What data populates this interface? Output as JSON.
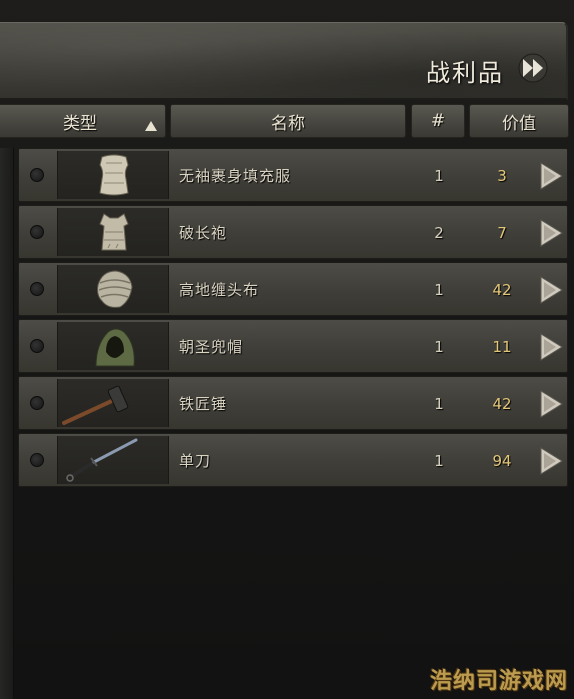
{
  "panel": {
    "title": "战利品",
    "fast_forward_icon": "fast-forward-icon"
  },
  "columns": {
    "type": "类型",
    "name": "名称",
    "count": "#",
    "value": "价值"
  },
  "items": [
    {
      "icon": "sleeveless-padded-vest-icon",
      "name": "无袖裹身填充服",
      "count": "1",
      "value": "3"
    },
    {
      "icon": "tattered-robe-icon",
      "name": "破长袍",
      "count": "2",
      "value": "7"
    },
    {
      "icon": "highland-head-wrap-icon",
      "name": "高地缠头布",
      "count": "1",
      "value": "42"
    },
    {
      "icon": "pilgrim-hood-icon",
      "name": "朝圣兜帽",
      "count": "1",
      "value": "11"
    },
    {
      "icon": "smith-hammer-icon",
      "name": "铁匠锤",
      "count": "1",
      "value": "42"
    },
    {
      "icon": "single-blade-icon",
      "name": "单刀",
      "count": "1",
      "value": "94"
    }
  ],
  "watermark": "浩纳司游戏网",
  "colors": {
    "value_gold": "#e3c678",
    "text_light": "#d9d3c2",
    "stone": "#4f4e47"
  }
}
